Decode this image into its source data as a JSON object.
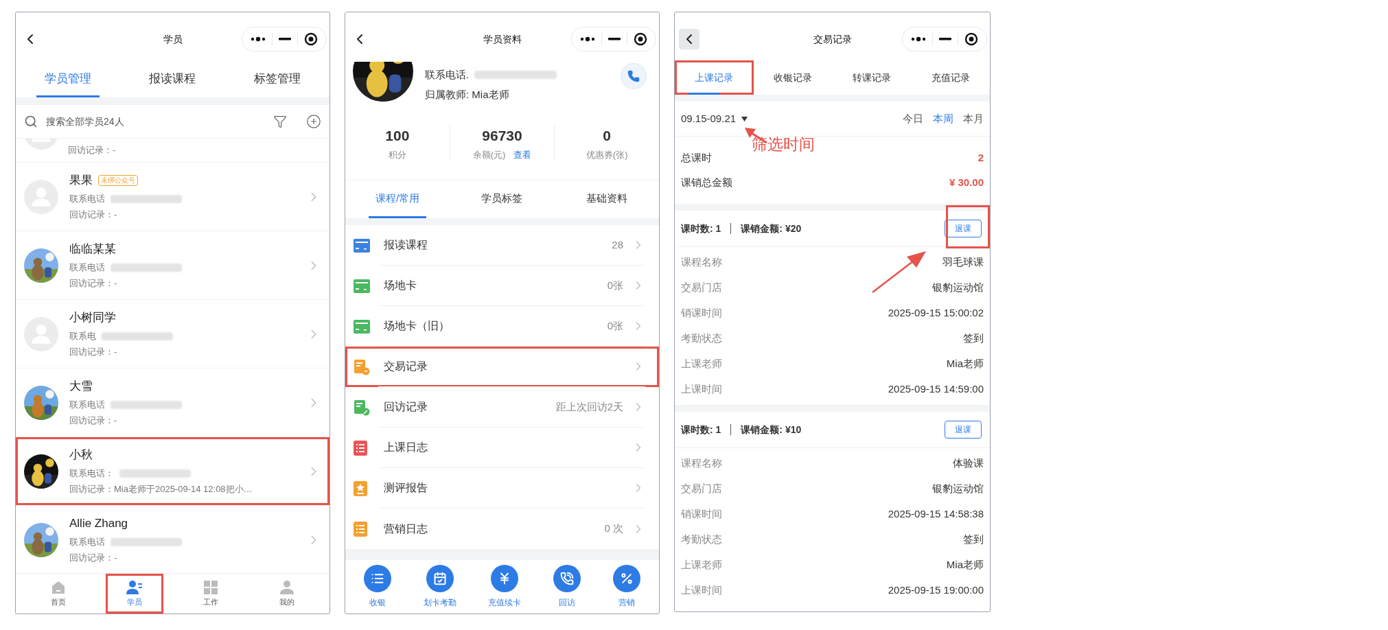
{
  "student_list": {
    "title": "学员",
    "tabs": [
      {
        "label": "学员管理",
        "selected": true
      },
      {
        "label": "报读课程",
        "selected": false
      },
      {
        "label": "标签管理",
        "selected": false
      }
    ],
    "search": {
      "placeholder": "搜索全部学员24人"
    },
    "rows": [
      {
        "kind": "partial",
        "visit": "回访记录：-"
      },
      {
        "kind": "full",
        "name": "果果",
        "badge": "未绑公众号",
        "phone_label": "联系电话",
        "visit": "回访记录：-",
        "highlighted": false
      },
      {
        "kind": "full",
        "name": "临临某某",
        "phone_label": "联系电话",
        "visit": "回访记录：-",
        "highlighted": false
      },
      {
        "kind": "full",
        "name": "小树同学",
        "phone_label": "联系电",
        "visit": "回访记录：-",
        "highlighted": false
      },
      {
        "kind": "full",
        "name": "大雪",
        "phone_label": "联系电话",
        "visit": "回访记录：-",
        "highlighted": false
      },
      {
        "kind": "full",
        "name": "小秋",
        "phone_label": "联系电话：",
        "visit": "回访记录：Mia老师于2025-09-14 12:08把小…",
        "highlighted": true
      },
      {
        "kind": "full",
        "name": "Allie Zhang",
        "phone_label": "联系电话",
        "visit": "回访记录：-",
        "highlighted": false
      }
    ],
    "tab_bar": [
      {
        "label": "首页",
        "selected": false,
        "highlighted": false
      },
      {
        "label": "学员",
        "selected": true,
        "highlighted": true
      },
      {
        "label": "工作",
        "selected": false,
        "highlighted": false
      },
      {
        "label": "我的",
        "selected": false,
        "highlighted": false
      }
    ]
  },
  "student_profile": {
    "title": "学员资料",
    "phone_label": "联系电话.",
    "teacher": "归属教师: Mia老师",
    "stats": [
      {
        "value": "100",
        "label": "积分"
      },
      {
        "value": "96730",
        "label": "余额(元)",
        "link": "查看"
      },
      {
        "value": "0",
        "label": "优惠券(张)"
      }
    ],
    "tabs": [
      {
        "label": "课程/常用",
        "selected": true
      },
      {
        "label": "学员标签",
        "selected": false
      },
      {
        "label": "基础资料",
        "selected": false
      }
    ],
    "menu": [
      {
        "label": "报读课程",
        "value": "28",
        "color": "#3b82e0",
        "highlighted": false
      },
      {
        "label": "场地卡",
        "value": "0张",
        "color": "#4cb860",
        "highlighted": false
      },
      {
        "label": "场地卡（旧）",
        "value": "0张",
        "color": "#4cb860",
        "highlighted": false
      },
      {
        "label": "交易记录",
        "color": "#f5a030",
        "highlighted": true
      },
      {
        "label": "回访记录",
        "value": "距上次回访2天",
        "color": "#4cb860",
        "highlighted": false
      },
      {
        "label": "上课日志",
        "color": "#ea5455",
        "highlighted": false
      },
      {
        "label": "测评报告",
        "color": "#f5a030",
        "highlighted": false
      },
      {
        "label": "营销日志",
        "value": "0 次",
        "color": "#f5a030",
        "highlighted": false
      }
    ],
    "actions": [
      {
        "label": "收银"
      },
      {
        "label": "划卡考勤"
      },
      {
        "label": "充值续卡"
      },
      {
        "label": "回访"
      },
      {
        "label": "营销"
      }
    ]
  },
  "transaction_records": {
    "title": "交易记录",
    "tabs": [
      {
        "label": "上课记录",
        "selected": true,
        "highlighted": true
      },
      {
        "label": "收银记录",
        "selected": false,
        "highlighted": false
      },
      {
        "label": "转课记录",
        "selected": false,
        "highlighted": false
      },
      {
        "label": "充值记录",
        "selected": false,
        "highlighted": false
      }
    ],
    "date_range": "09.15-09.21",
    "annotation": "筛选时间",
    "periods": [
      {
        "label": "今日",
        "selected": false
      },
      {
        "label": "本周",
        "selected": true
      },
      {
        "label": "本月",
        "selected": false
      }
    ],
    "summary": [
      {
        "label": "总课时",
        "value": "2"
      },
      {
        "label": "课销总金额",
        "value": "¥ 30.00"
      }
    ],
    "records": [
      {
        "count": "课时数: 1",
        "amount": "课销金额: ¥20",
        "button": "退课",
        "highlighted": true,
        "fields": [
          {
            "label": "课程名称",
            "value": "羽毛球课"
          },
          {
            "label": "交易门店",
            "value": "银豹运动馆"
          },
          {
            "label": "销课时间",
            "value": "2025-09-15 15:00:02"
          },
          {
            "label": "考勤状态",
            "value": "签到"
          },
          {
            "label": "上课老师",
            "value": "Mia老师"
          },
          {
            "label": "上课时间",
            "value": "2025-09-15 14:59:00"
          }
        ]
      },
      {
        "count": "课时数: 1",
        "amount": "课销金额: ¥10",
        "button": "退课",
        "highlighted": false,
        "fields": [
          {
            "label": "课程名称",
            "value": "体验课"
          },
          {
            "label": "交易门店",
            "value": "银豹运动馆"
          },
          {
            "label": "销课时间",
            "value": "2025-09-15 14:58:38"
          },
          {
            "label": "考勤状态",
            "value": "签到"
          },
          {
            "label": "上课老师",
            "value": "Mia老师"
          },
          {
            "label": "上课时间",
            "value": "2025-09-15 19:00:00"
          }
        ]
      }
    ]
  }
}
